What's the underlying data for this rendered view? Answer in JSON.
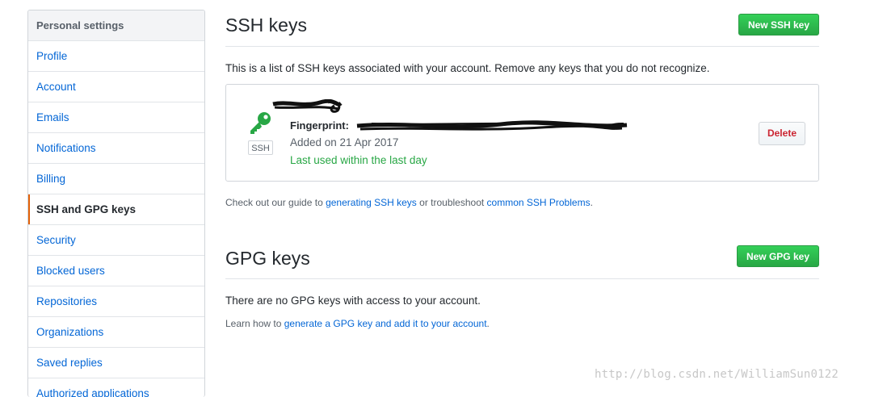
{
  "sidebar": {
    "header": "Personal settings",
    "items": [
      {
        "label": "Profile"
      },
      {
        "label": "Account"
      },
      {
        "label": "Emails"
      },
      {
        "label": "Notifications"
      },
      {
        "label": "Billing"
      },
      {
        "label": "SSH and GPG keys"
      },
      {
        "label": "Security"
      },
      {
        "label": "Blocked users"
      },
      {
        "label": "Repositories"
      },
      {
        "label": "Organizations"
      },
      {
        "label": "Saved replies"
      },
      {
        "label": "Authorized applications"
      }
    ],
    "active_index": 5
  },
  "ssh": {
    "title": "SSH keys",
    "new_button": "New SSH key",
    "description": "This is a list of SSH keys associated with your account. Remove any keys that you do not recognize.",
    "key": {
      "type_badge": "SSH",
      "fingerprint_label": "Fingerprint:",
      "added": "Added on 21 Apr 2017",
      "last_used": "Last used within the last day",
      "delete_button": "Delete"
    },
    "guide": {
      "prefix": "Check out our guide to ",
      "link1": "generating SSH keys",
      "middle": " or troubleshoot ",
      "link2": "common SSH Problems",
      "suffix": "."
    }
  },
  "gpg": {
    "title": "GPG keys",
    "new_button": "New GPG key",
    "description": "There are no GPG keys with access to your account.",
    "learn": {
      "prefix": "Learn how to ",
      "link": "generate a GPG key and add it to your account",
      "suffix": "."
    }
  },
  "watermark": "http://blog.csdn.net/WilliamSun0122",
  "colors": {
    "accent_link": "#0366d6",
    "active_marker": "#e36209",
    "green_button": "#28a745",
    "delete_text": "#cb2431",
    "key_icon": "#28a745"
  }
}
